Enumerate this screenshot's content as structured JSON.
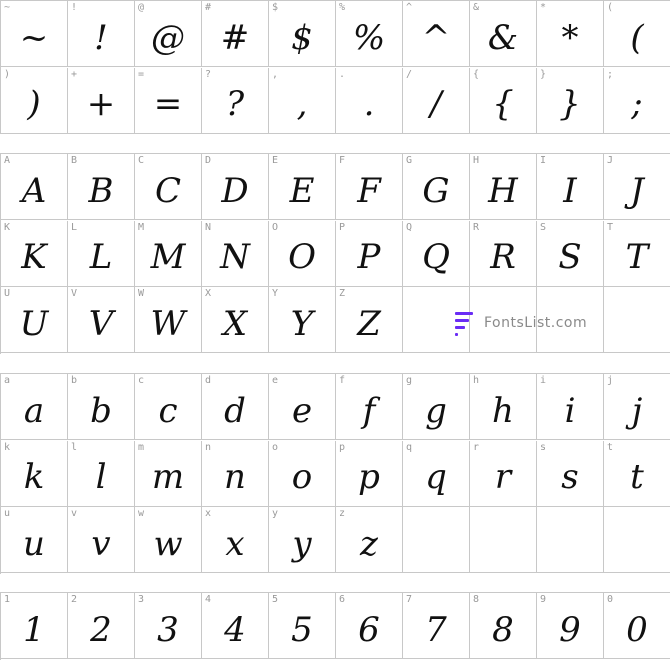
{
  "rows": {
    "symbols": [
      [
        "~",
        "!",
        "@",
        "#",
        "$",
        "%",
        "^",
        "&",
        "*",
        "("
      ],
      [
        ")",
        "+",
        "=",
        "?",
        ",",
        ".",
        "/",
        "{",
        "}",
        ";"
      ]
    ],
    "upper": [
      [
        "A",
        "B",
        "C",
        "D",
        "E",
        "F",
        "G",
        "H",
        "I",
        "J"
      ],
      [
        "K",
        "L",
        "M",
        "N",
        "O",
        "P",
        "Q",
        "R",
        "S",
        "T"
      ],
      [
        "U",
        "V",
        "W",
        "X",
        "Y",
        "Z",
        "",
        "",
        "",
        ""
      ]
    ],
    "lower": [
      [
        "a",
        "b",
        "c",
        "d",
        "e",
        "f",
        "g",
        "h",
        "i",
        "j"
      ],
      [
        "k",
        "l",
        "m",
        "n",
        "o",
        "p",
        "q",
        "r",
        "s",
        "t"
      ],
      [
        "u",
        "v",
        "w",
        "x",
        "y",
        "z",
        "",
        "",
        "",
        ""
      ]
    ],
    "digits": [
      [
        "1",
        "2",
        "3",
        "4",
        "5",
        "6",
        "7",
        "8",
        "9",
        "0"
      ]
    ]
  },
  "logo": {
    "text": "FontsList.com",
    "color": "#6a2cf5"
  }
}
